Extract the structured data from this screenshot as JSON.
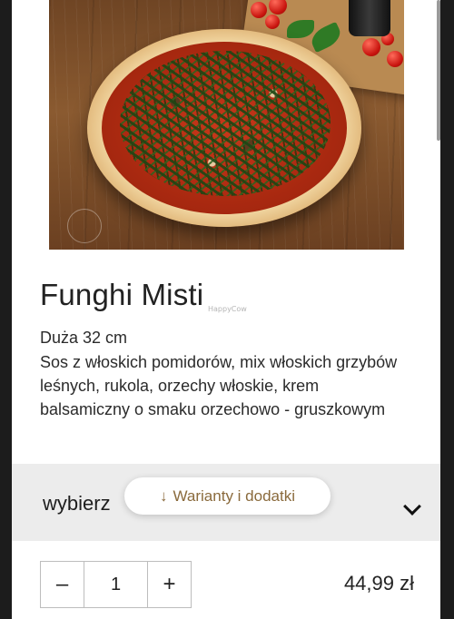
{
  "product": {
    "name": "Funghi Misti",
    "size": "Duża 32 cm",
    "description": "Sos z włoskich pomidorów, mix włoskich grzybów leśnych, rukola, orzechy włoskie, krem balsamiczny o smaku orzechowo - gruszkowym",
    "watermark": "HappyCow"
  },
  "variants": {
    "label": "wybierz",
    "hint_arrow": "↓",
    "hint_text": "Warianty i dodatki"
  },
  "order": {
    "minus_label": "–",
    "quantity": "1",
    "plus_label": "+",
    "price": "44,99 zł"
  },
  "colors": {
    "accent": "#8a6a3c",
    "variants_bg": "#ececec",
    "frame_bg": "#1c1c1c"
  },
  "icons": {
    "chevron": "chevron-down-icon",
    "arrow": "arrow-down-icon"
  }
}
